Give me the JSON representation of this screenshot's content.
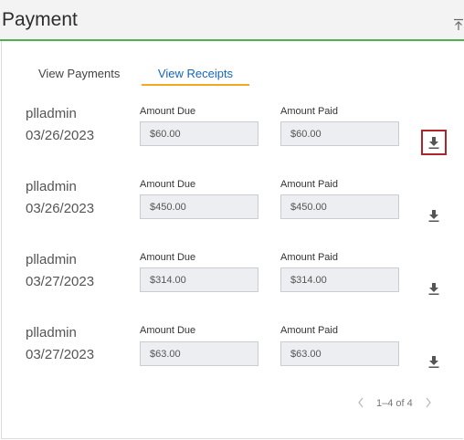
{
  "header": {
    "title": "Payment",
    "collapse_icon": "collapse-up-icon"
  },
  "tabs": [
    {
      "label": "View Payments",
      "active": false
    },
    {
      "label": "View Receipts",
      "active": true
    }
  ],
  "receipts": [
    {
      "user": "plladmin",
      "date": "03/26/2023",
      "due_label": "Amount Due",
      "due": "$60.00",
      "paid_label": "Amount Paid",
      "paid": "$60.00",
      "download_icon": "download-icon",
      "selected": true
    },
    {
      "user": "plladmin",
      "date": "03/26/2023",
      "due_label": "Amount Due",
      "due": "$450.00",
      "paid_label": "Amount Paid",
      "paid": "$450.00",
      "download_icon": "download-icon",
      "selected": false
    },
    {
      "user": "plladmin",
      "date": "03/27/2023",
      "due_label": "Amount Due",
      "due": "$314.00",
      "paid_label": "Amount Paid",
      "paid": "$314.00",
      "download_icon": "download-icon",
      "selected": false
    },
    {
      "user": "plladmin",
      "date": "03/27/2023",
      "due_label": "Amount Due",
      "due": "$63.00",
      "paid_label": "Amount Paid",
      "paid": "$63.00",
      "download_icon": "download-icon",
      "selected": false
    }
  ],
  "pagination": {
    "text": "1–4 of 4",
    "prev_icon": "chevron-left-icon",
    "next_icon": "chevron-right-icon"
  },
  "colors": {
    "accent_green": "#4caf50",
    "tab_underline": "#f5a623",
    "selection_border": "#b0232a",
    "link_blue": "#1565c0"
  }
}
